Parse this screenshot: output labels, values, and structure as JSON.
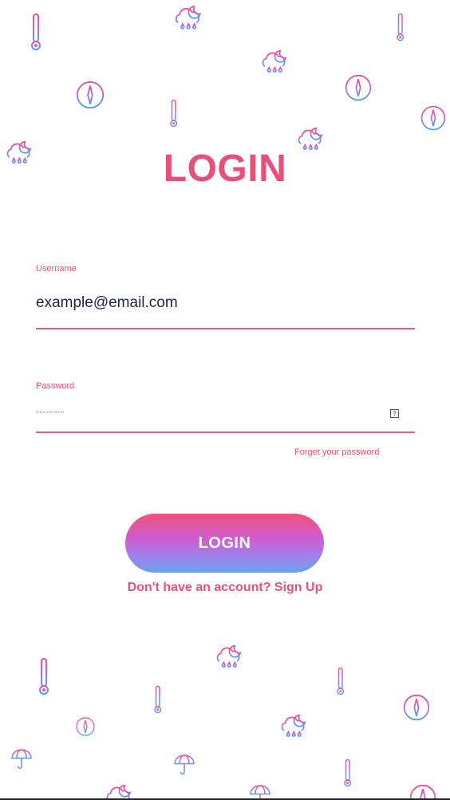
{
  "title": "LOGIN",
  "username": {
    "label": "Username",
    "value": "example@email.com"
  },
  "password": {
    "label": "Password",
    "masked_value": "▫▫▫▫▫▫▫▫",
    "toggle_glyph": "?"
  },
  "forgot_label": "Forget your password",
  "login_button_label": "LOGIN",
  "signup_label": "Don't have an account? Sign Up",
  "colors": {
    "accent": "#e85079",
    "gradient_top": "#ef5278",
    "gradient_mid": "#cf5bd0",
    "gradient_bottom": "#6ba2ee",
    "text_dark": "#1e2448"
  },
  "decorations": [
    "thermometer-icon",
    "cloud-rain-moon-icon",
    "compass-icon",
    "umbrella-icon"
  ]
}
